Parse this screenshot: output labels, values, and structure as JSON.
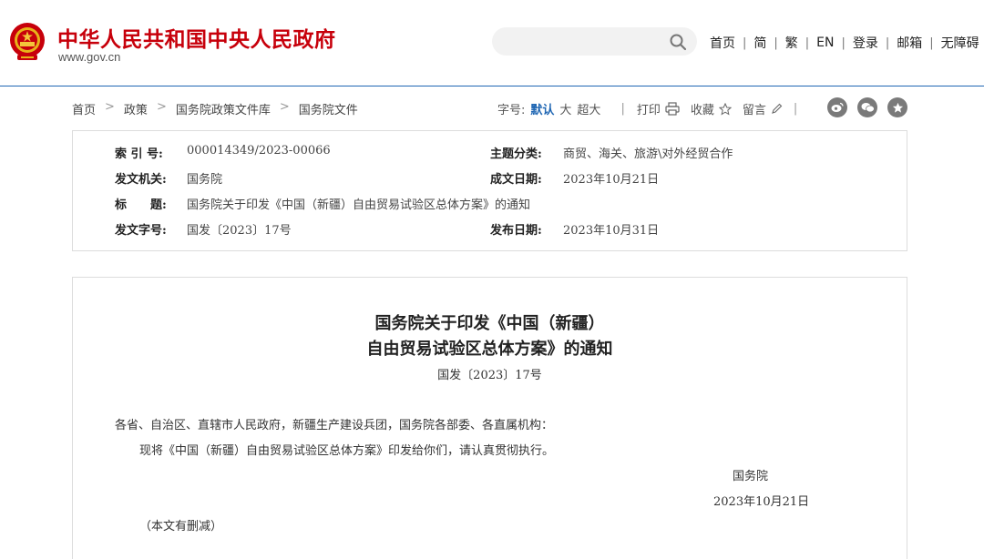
{
  "header": {
    "site_title": "中华人民共和国中央人民政府",
    "site_url": "www.gov.cn",
    "search": {
      "placeholder": "",
      "value": ""
    },
    "nav": [
      "首页",
      "简",
      "繁",
      "EN",
      "登录",
      "邮箱",
      "无障碍"
    ],
    "brand_color": "#c7000b",
    "accent_color": "#1f66b3"
  },
  "breadcrumb": [
    "首页",
    "政策",
    "国务院政策文件库",
    "国务院文件"
  ],
  "tools": {
    "font_size_label": "字号:",
    "font_sizes": [
      "默认",
      "大",
      "超大"
    ],
    "print": "打印",
    "favorite": "收藏",
    "comment": "留言",
    "share_icons": [
      "weibo-icon",
      "wechat-icon",
      "star-share-icon"
    ]
  },
  "meta": {
    "index_no_label": "索  引  号:",
    "index_no": "000014349/2023-00066",
    "category_label": "主题分类:",
    "category": "商贸、海关、旅游\\对外经贸合作",
    "issuer_label": "发文机关:",
    "issuer": "国务院",
    "written_date_label": "成文日期:",
    "written_date": "2023年10月21日",
    "title_label": "标　　题:",
    "title": "国务院关于印发《中国（新疆）自由贸易试验区总体方案》的通知",
    "doc_no_label": "发文字号:",
    "doc_no": "国发〔2023〕17号",
    "publish_date_label": "发布日期:",
    "publish_date": "2023年10月31日"
  },
  "document": {
    "title_line1": "国务院关于印发《中国（新疆）",
    "title_line2": "自由贸易试验区总体方案》的通知",
    "doc_no": "国发〔2023〕17号",
    "addressee": "各省、自治区、直辖市人民政府，新疆生产建设兵团，国务院各部委、各直属机构：",
    "body": "现将《中国（新疆）自由贸易试验区总体方案》印发给你们，请认真贯彻执行。",
    "signature": "国务院",
    "date": "2023年10月21日",
    "note": "（本文有删减）"
  }
}
